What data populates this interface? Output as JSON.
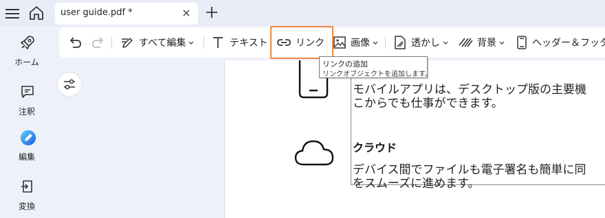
{
  "tab": {
    "title": "user guide.pdf *"
  },
  "rail": {
    "items": [
      {
        "label": "ホーム",
        "icon": "rocket-icon"
      },
      {
        "label": "注釈",
        "icon": "comment-icon"
      },
      {
        "label": "編集",
        "icon": "edit-ai-icon"
      },
      {
        "label": "変換",
        "icon": "convert-icon"
      }
    ]
  },
  "toolbar": {
    "edit_all": "すべて編集",
    "text": "テキスト",
    "link": "リンク",
    "image": "画像",
    "watermark": "透かし",
    "background": "背景",
    "header_footer": "ヘッダー＆フッター"
  },
  "tooltip": {
    "title": "リンクの追加",
    "description": "リンクオブジェクトを追加します。"
  },
  "document": {
    "mobile_line1": "モバイルアプリは、デスクトップ版の主要機",
    "mobile_line2": "こからでも仕事ができます。",
    "cloud_heading": "クラウド",
    "cloud_line1": "デバイス間でファイルも電子署名も簡単に同",
    "cloud_line2": "をスムーズに進めます。"
  },
  "colors": {
    "highlight": "#f0883c",
    "accent": "#2e7bf6"
  }
}
